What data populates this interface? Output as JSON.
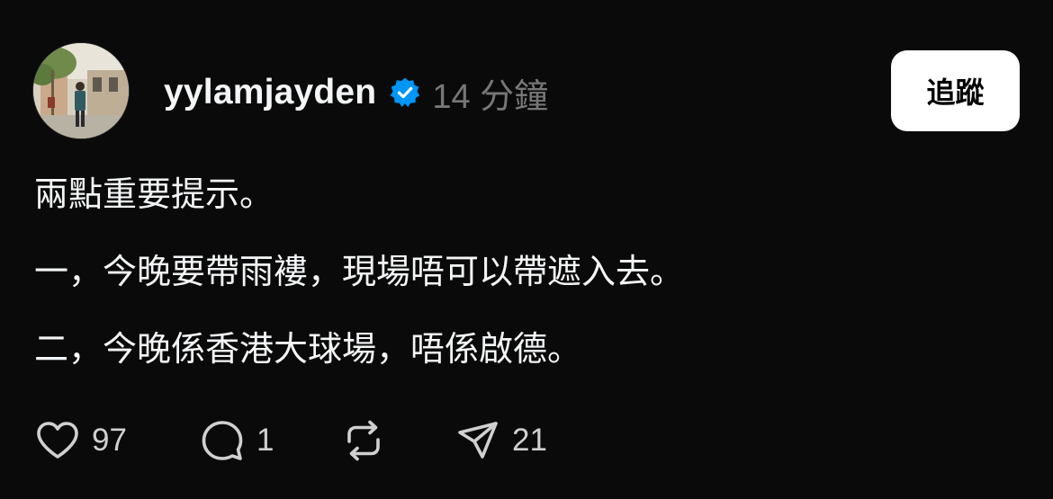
{
  "post": {
    "username": "yylamjayden",
    "time": "14 分鐘",
    "follow_label": "追蹤",
    "lines": [
      "兩點重要提示。",
      "一，今晚要帶雨褸，現場唔可以帶遮入去。",
      "二，今晚係香港大球場，唔係啟德。"
    ],
    "actions": {
      "like_count": "97",
      "reply_count": "1",
      "repost_count": "",
      "share_count": "21"
    }
  },
  "icons": {
    "verified": "verified-badge-icon",
    "like": "heart-icon",
    "reply": "comment-bubble-icon",
    "repost": "repost-icon",
    "share": "send-icon"
  },
  "colors": {
    "background": "#0a0a0a",
    "verified": "#0095f6",
    "muted": "#777777",
    "text": "#f3f5f7"
  }
}
